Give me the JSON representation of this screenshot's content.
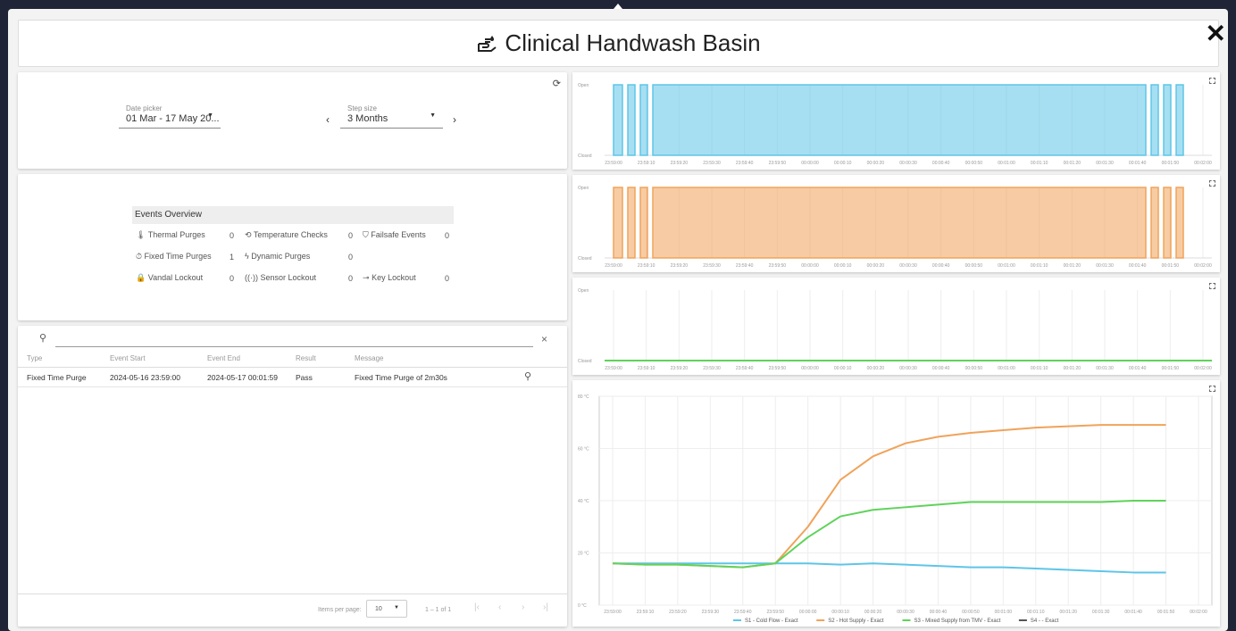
{
  "title": "Clinical Handwash Basin",
  "close_label": "✕",
  "date_picker": {
    "label": "Date picker",
    "value": "01 Mar - 17 May 20..."
  },
  "step_size": {
    "label": "Step size",
    "value": "3 Months"
  },
  "events_overview": {
    "title": "Events Overview",
    "items": [
      {
        "label": "Thermal Purges",
        "value": "0"
      },
      {
        "label": "Temperature Checks",
        "value": "0"
      },
      {
        "label": "Failsafe Events",
        "value": "0"
      },
      {
        "label": "Fixed Time Purges",
        "value": "1"
      },
      {
        "label": "Dynamic Purges",
        "value": "0"
      },
      {
        "label": "Vandal Lockout",
        "value": "0"
      },
      {
        "label": "Sensor Lockout",
        "value": "0"
      },
      {
        "label": "Key Lockout",
        "value": "0"
      }
    ]
  },
  "table": {
    "headers": [
      "Type",
      "Event Start",
      "Event End",
      "Result",
      "Message"
    ],
    "rows": [
      [
        "Fixed Time Purge",
        "2024-05-16 23:59:00",
        "2024-05-17 00:01:59",
        "Pass",
        "Fixed Time Purge of 2m30s"
      ]
    ],
    "items_per_page_label": "Items per page:",
    "items_per_page": "10",
    "range": "1 – 1 of 1"
  },
  "valve_labels": {
    "open": "Open",
    "closed": "Closed"
  },
  "x_ticks": [
    "23:59:00",
    "23:59:10",
    "23:59:20",
    "23:59:30",
    "23:59:40",
    "23:59:50",
    "00:00:00",
    "00:00:10",
    "00:00:20",
    "00:00:30",
    "00:00:40",
    "00:00:50",
    "00:01:00",
    "00:01:10",
    "00:01:20",
    "00:01:30",
    "00:01:40",
    "00:01:50",
    "00:02:00"
  ],
  "colors": {
    "cold": "#5ec5e8",
    "hot": "#f0a35a",
    "mixed": "#5fd35a",
    "s4": "#555555"
  },
  "chart_data": [
    {
      "type": "area",
      "title": "",
      "ylabel": "",
      "categories": [
        "Closed",
        "Open"
      ],
      "series": [
        {
          "values": [
            0,
            1,
            0,
            1,
            0,
            1,
            0,
            1,
            1,
            1,
            1,
            1,
            1,
            1,
            1,
            1,
            1,
            1,
            0,
            1,
            0,
            1,
            0,
            1,
            0
          ]
        }
      ]
    },
    {
      "type": "area",
      "title": "",
      "ylabel": "",
      "categories": [
        "Closed",
        "Open"
      ],
      "series": [
        {
          "values": [
            0,
            1,
            0,
            1,
            0,
            1,
            0,
            1,
            1,
            1,
            1,
            1,
            1,
            1,
            1,
            1,
            1,
            1,
            0,
            1,
            0,
            1,
            0,
            1,
            0
          ]
        }
      ]
    },
    {
      "type": "line",
      "title": "",
      "ylabel": "",
      "categories": [
        "Closed",
        "Open"
      ],
      "series": [
        {
          "values": [
            0,
            0
          ]
        }
      ]
    },
    {
      "type": "line",
      "title": "",
      "xlabel": "",
      "ylabel": "",
      "ylim": [
        0,
        80
      ],
      "y_ticks": [
        "0 °C",
        "20 °C",
        "40 °C",
        "60 °C",
        "80 °C"
      ],
      "x": [
        "23:59:00",
        "23:59:10",
        "23:59:20",
        "23:59:30",
        "23:59:40",
        "23:59:50",
        "00:00:00",
        "00:00:10",
        "00:00:20",
        "00:00:30",
        "00:00:40",
        "00:00:50",
        "00:01:00",
        "00:01:10",
        "00:01:20",
        "00:01:30",
        "00:01:40",
        "00:01:50"
      ],
      "series": [
        {
          "name": "S1 - Cold Flow - Exact",
          "values": [
            16,
            16,
            16,
            16,
            16,
            16,
            16,
            15.5,
            16,
            15.5,
            15,
            14.5,
            14.5,
            14,
            13.5,
            13,
            12.5,
            12.5
          ]
        },
        {
          "name": "S2 - Hot Supply - Exact",
          "values": [
            16,
            15.5,
            15.5,
            15,
            14.5,
            16,
            30,
            48,
            57,
            62,
            64.5,
            66,
            67,
            68,
            68.5,
            69,
            69,
            69
          ]
        },
        {
          "name": "S3 - Mixed Supply from TMV - Exact",
          "values": [
            16,
            15.5,
            15.5,
            15,
            14.5,
            16,
            26,
            34,
            36.5,
            37.5,
            38.5,
            39.5,
            39.5,
            39.5,
            39.5,
            39.5,
            40,
            40
          ]
        },
        {
          "name": "S4 - - Exact",
          "values": []
        }
      ]
    }
  ]
}
